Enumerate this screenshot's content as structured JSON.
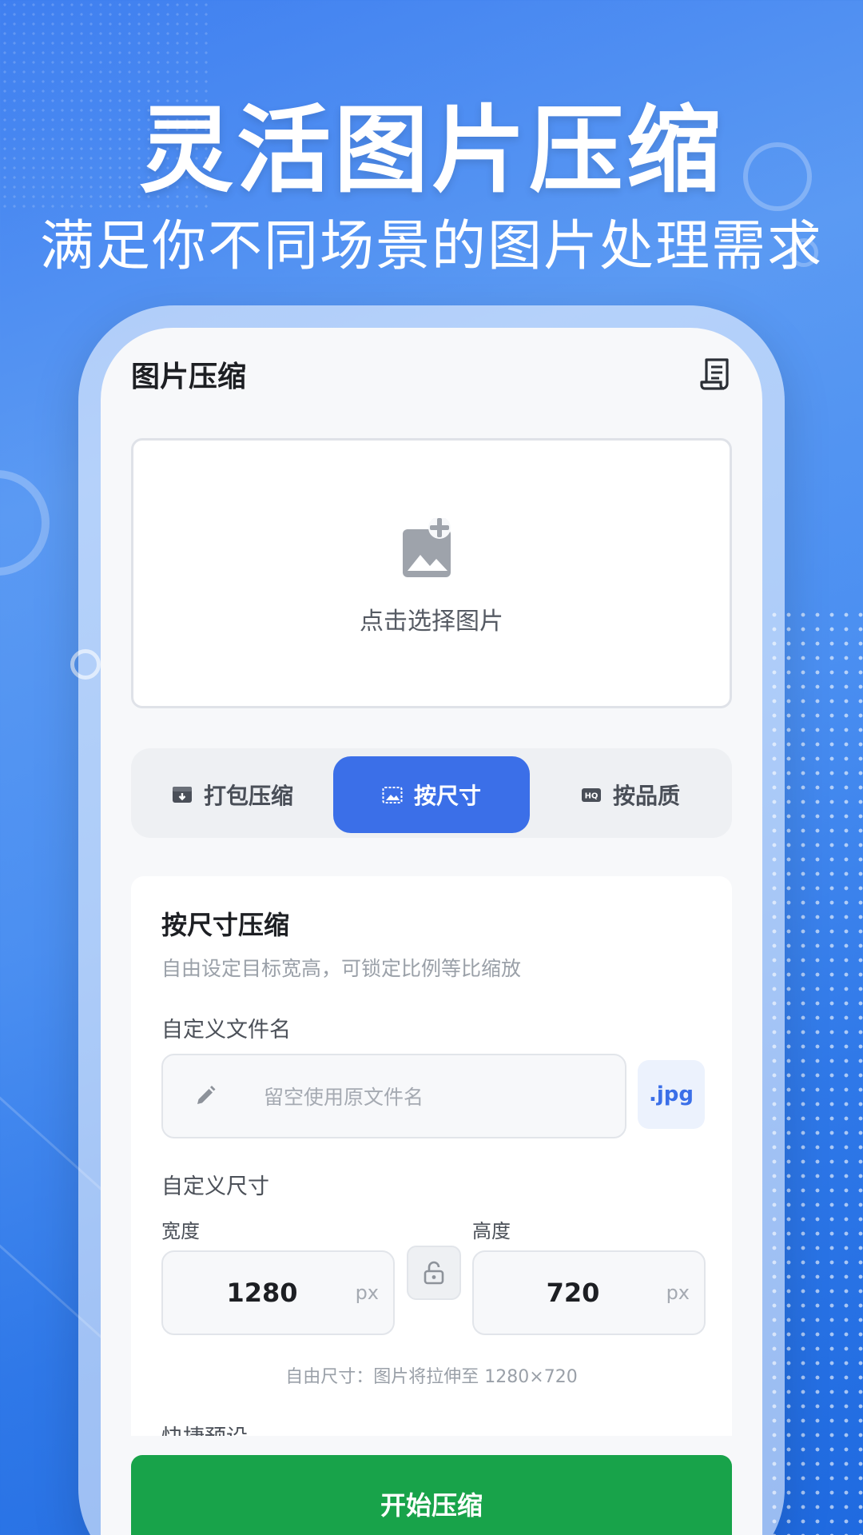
{
  "hero": {
    "title": "灵活图片压缩",
    "subtitle": "满足你不同场景的图片处理需求"
  },
  "app": {
    "title": "图片压缩",
    "header_icon": "document-icon"
  },
  "upload": {
    "icon": "add-image-icon",
    "label": "点击选择图片"
  },
  "modes": [
    {
      "label": "打包压缩",
      "icon": "archive-icon",
      "active": false
    },
    {
      "label": "按尺寸",
      "icon": "resize-icon",
      "active": true
    },
    {
      "label": "按品质",
      "icon": "hq-icon",
      "active": false
    }
  ],
  "card": {
    "title": "按尺寸压缩",
    "description": "自由设定目标宽高，可锁定比例等比缩放",
    "filename_label": "自定义文件名",
    "filename_placeholder": "留空使用原文件名",
    "extension": ".jpg",
    "size_label": "自定义尺寸",
    "width_label": "宽度",
    "width_value": "1280",
    "height_label": "高度",
    "height_value": "720",
    "unit": "px",
    "hint": "自由尺寸：图片将拉伸至 1280×720",
    "presets_label": "快捷预设"
  },
  "actions": {
    "start_label": "开始压缩"
  },
  "colors": {
    "primary": "#3b6fe8",
    "start_button": "#18a34a"
  }
}
